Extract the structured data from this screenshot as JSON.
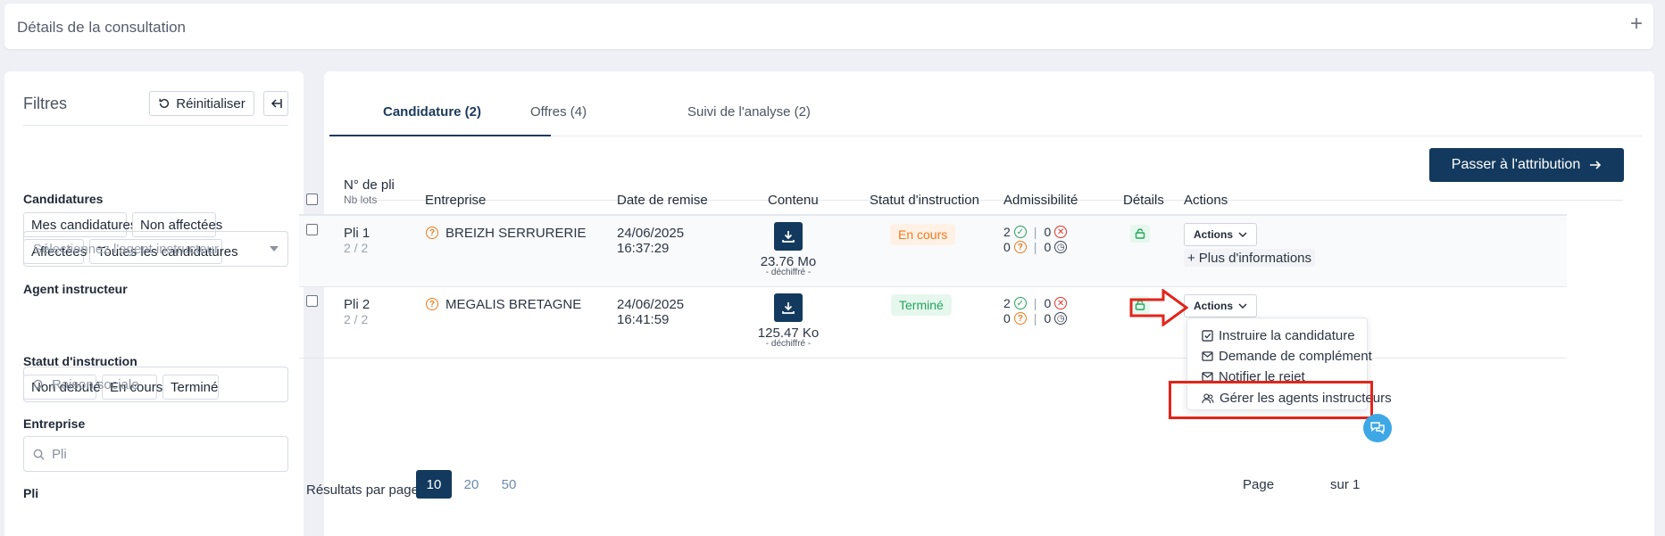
{
  "header": {
    "title": "Détails de la consultation",
    "expand_icon": "plus-icon"
  },
  "filters": {
    "title": "Filtres",
    "reset_label": "Réinitialiser",
    "sections": {
      "candidatures": {
        "label": "Candidatures",
        "options": [
          "Mes candidatures",
          "Non affectées",
          "Affectées",
          "Toutes les candidatures"
        ]
      },
      "agent": {
        "label": "Agent instructeur",
        "placeholder": "Sélectionnez l'agent instructeur"
      },
      "statut": {
        "label": "Statut d'instruction",
        "options": [
          "Non debuté",
          "En cours",
          "Terminé"
        ]
      },
      "entreprise": {
        "label": "Entreprise",
        "placeholder": "Raison sociale"
      },
      "pli": {
        "label": "Pli",
        "placeholder": "Pli"
      }
    }
  },
  "tabs": [
    {
      "label": "Candidature (2)",
      "active": true
    },
    {
      "label": "Offres (4)",
      "active": false
    },
    {
      "label": "Suivi de l'analyse (2)",
      "active": false
    }
  ],
  "primary_action": {
    "label": "Passer à l'attribution"
  },
  "table": {
    "headers": {
      "pli": "N° de pli",
      "pli_sub": "Nb lots",
      "entreprise": "Entreprise",
      "date": "Date de remise",
      "contenu": "Contenu",
      "statut": "Statut d'instruction",
      "admissibilite": "Admissibilité",
      "details": "Détails",
      "actions": "Actions"
    },
    "rows": [
      {
        "pli": "Pli 1",
        "lots": "2 / 2",
        "entreprise": "BREIZH SERRURERIE",
        "date": "24/06/2025",
        "time": "16:37:29",
        "size": "23.76 Mo",
        "size_sub": "- déchiffré -",
        "statut": "En cours",
        "statut_color": "#f07b1d",
        "adm_ok": "2",
        "adm_ko": "0",
        "adm_q": "0",
        "adm_wait": "0",
        "actions_label": "Actions",
        "more_info": "Plus d'informations"
      },
      {
        "pli": "Pli 2",
        "lots": "2 / 2",
        "entreprise": "MEGALIS BRETAGNE",
        "date": "24/06/2025",
        "time": "16:41:59",
        "size": "125.47 Ko",
        "size_sub": "- déchiffré -",
        "statut": "Terminé",
        "statut_color": "#23a55a",
        "adm_ok": "2",
        "adm_ko": "0",
        "adm_q": "0",
        "adm_wait": "0",
        "actions_label": "Actions"
      }
    ]
  },
  "pagination": {
    "label": "Résultats par page :",
    "options": [
      "10",
      "20",
      "50"
    ],
    "selected": "10",
    "page_label": "Page",
    "of_label": "sur 1"
  },
  "menu": {
    "items": [
      "Instruire la candidature",
      "Demande de complément",
      "Notifier le rejet",
      "Gérer les agents instructeurs"
    ]
  },
  "colors": {
    "primary": "#133a5e",
    "annotation": "#e1251b",
    "chat": "#3ea8e6"
  }
}
